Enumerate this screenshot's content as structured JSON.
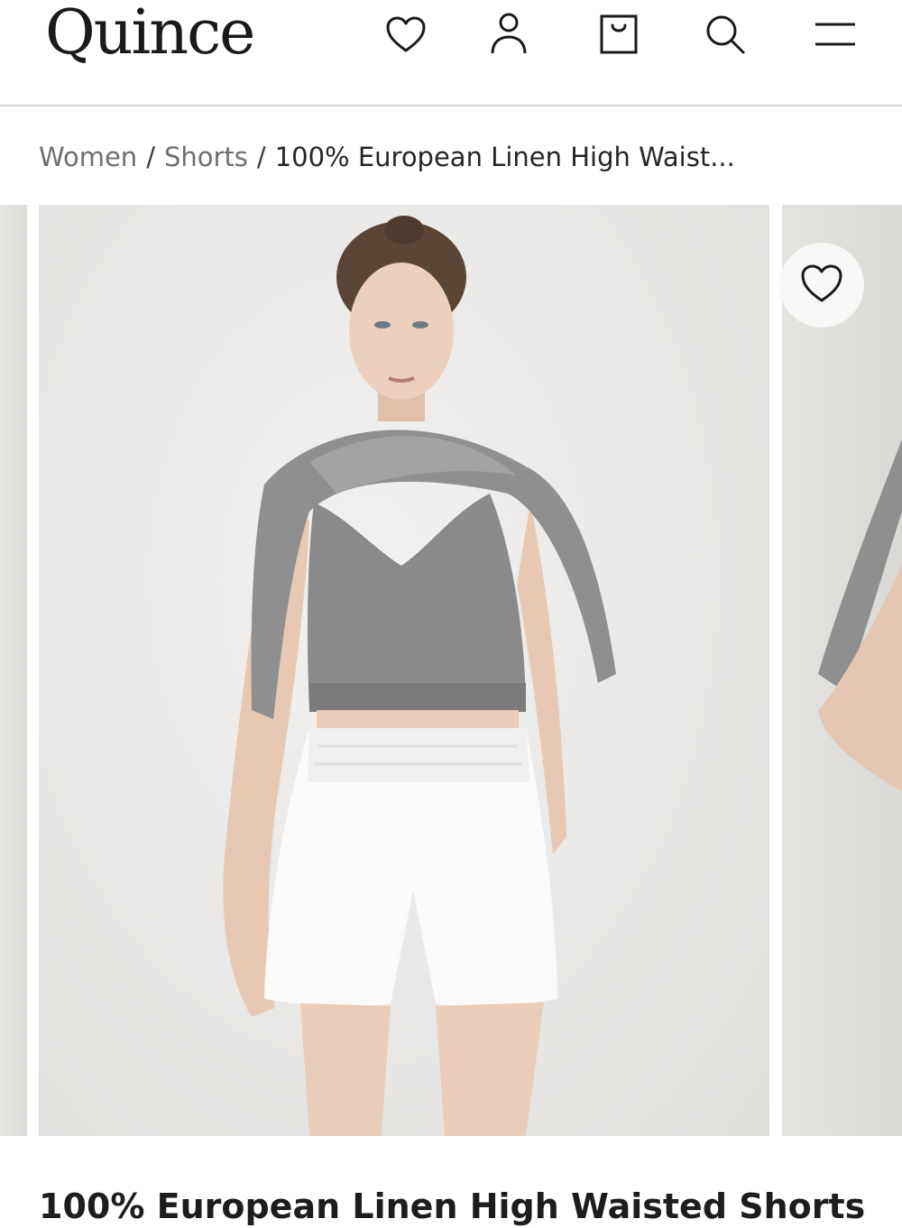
{
  "header": {
    "logo": "Quince",
    "icons": [
      "heart-icon",
      "account-icon",
      "shopping-bag-icon",
      "search-icon",
      "menu-icon"
    ]
  },
  "breadcrumb": {
    "items": [
      "Women",
      "Shorts"
    ],
    "separator": "/",
    "current": "100% European Linen High Waist..."
  },
  "gallery": {
    "favorite_icon": "heart-icon"
  },
  "product": {
    "title": "100% European Linen High Waisted Shorts"
  },
  "colors": {
    "text": "#1f1f1f",
    "link": "#6f6f6f",
    "divider": "#d6d6d6"
  }
}
